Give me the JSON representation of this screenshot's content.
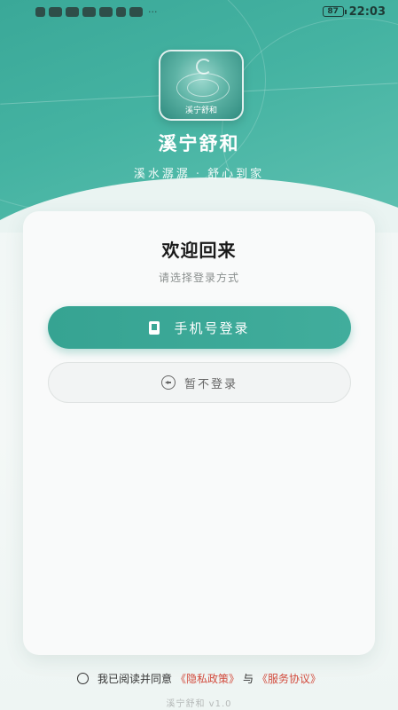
{
  "status_bar": {
    "battery": "87",
    "time": "22:03",
    "more": "···"
  },
  "app": {
    "logo_text": "溪宁舒和",
    "title": "溪宁舒和",
    "slogan_left": "溪水潺潺",
    "slogan_sep": "·",
    "slogan_right": "舒心到家"
  },
  "card": {
    "welcome": "欢迎回来",
    "subtitle": "请选择登录方式",
    "phone_login_label": "手机号登录",
    "skip_login_label": "暂不登录"
  },
  "agreement": {
    "prefix": "我已阅读并同意",
    "privacy_link": "《隐私政策》",
    "conjunction": "与",
    "service_link": "《服务协议》"
  },
  "footer": {
    "version": "溪宁舒和 v1.0"
  },
  "colors": {
    "accent": "#3aa898",
    "link": "#d24a3c"
  }
}
